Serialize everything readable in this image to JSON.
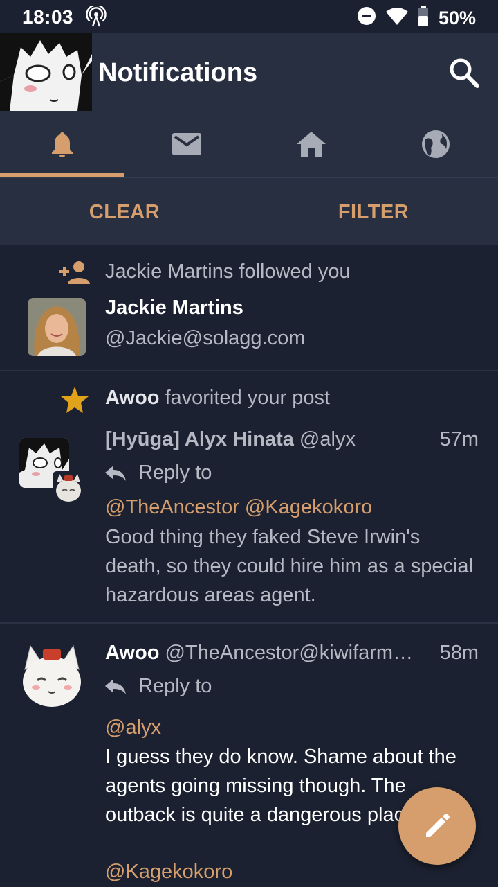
{
  "status_bar": {
    "time": "18:03",
    "battery": "50%"
  },
  "app_bar": {
    "title": "Notifications"
  },
  "tabs": [
    {
      "name": "notifications",
      "icon": "bell-icon",
      "active": true
    },
    {
      "name": "direct-messages",
      "icon": "envelope-icon",
      "active": false
    },
    {
      "name": "home",
      "icon": "home-icon",
      "active": false
    },
    {
      "name": "federated",
      "icon": "globe-icon",
      "active": false
    }
  ],
  "actions": {
    "clear": "CLEAR",
    "filter": "FILTER"
  },
  "colors": {
    "accent": "#d59e6c",
    "favorite": "#e0a21a",
    "background": "#1b2130",
    "surface": "#282f40"
  },
  "notifications": [
    {
      "type": "follow",
      "icon": "person-add-icon",
      "text": "Jackie Martins followed you",
      "account": {
        "display_name": "Jackie Martins",
        "handle": "@Jackie@solagg.com"
      }
    },
    {
      "type": "favorite",
      "icon": "star-icon",
      "actor": "Awoo",
      "text": " favorited your post",
      "status": {
        "display_name": "[Hyūga] Alyx Hinata",
        "acct": " @alyx",
        "time": "57m",
        "reply_label": "Reply to",
        "mentions": "@TheAncestor @Kagekokoro",
        "content": "Good thing they faked Steve Irwin's death, so they could hire him as a special hazardous areas agent."
      }
    },
    {
      "type": "mention",
      "status": {
        "display_name": "Awoo",
        "acct": " @TheAncestor@kiwifarm…",
        "time": "58m",
        "reply_label": "Reply to",
        "mentions": "@alyx",
        "content": "I guess they do know. Shame about the agents going missing though. The outback is quite a dangerous place I hear.",
        "trailing_mention": "@Kagekokoro"
      }
    }
  ]
}
